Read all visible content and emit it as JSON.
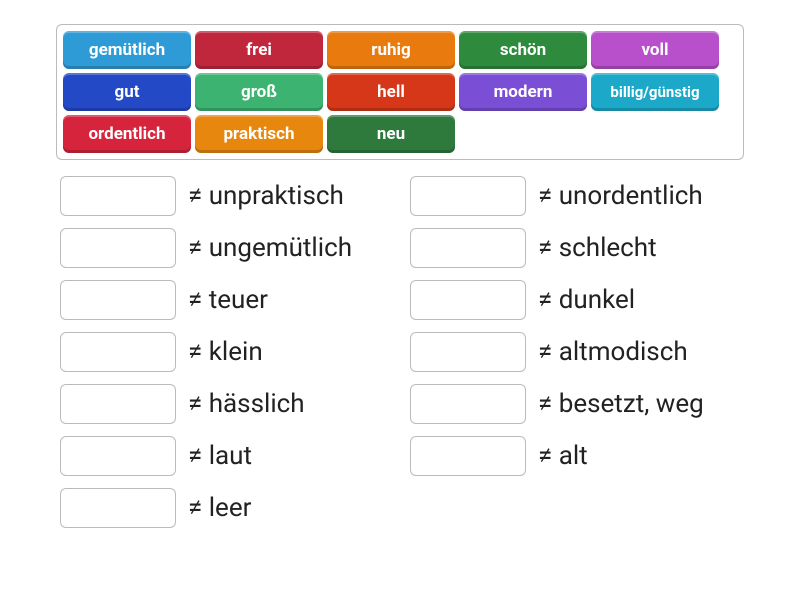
{
  "tiles": [
    {
      "text": "gemütlich",
      "color": "#2E9BD6"
    },
    {
      "text": "frei",
      "color": "#C0273C"
    },
    {
      "text": "ruhig",
      "color": "#E87A0E"
    },
    {
      "text": "schön",
      "color": "#2E8B3D"
    },
    {
      "text": "voll",
      "color": "#B84FCB"
    },
    {
      "text": "gut",
      "color": "#2449C6"
    },
    {
      "text": "groß",
      "color": "#3CB371"
    },
    {
      "text": "hell",
      "color": "#D63718"
    },
    {
      "text": "modern",
      "color": "#7A4FD6"
    },
    {
      "text": "billig/günstig",
      "color": "#1CA8C9"
    },
    {
      "text": "ordentlich",
      "color": "#D6243C"
    },
    {
      "text": "praktisch",
      "color": "#E8870E"
    },
    {
      "text": "neu",
      "color": "#2E7A3D"
    }
  ],
  "pairs": [
    {
      "label": "≠ unpraktisch"
    },
    {
      "label": "≠ ungemütlich"
    },
    {
      "label": "≠ teuer"
    },
    {
      "label": "≠ klein"
    },
    {
      "label": "≠ hässlich"
    },
    {
      "label": "≠ laut"
    },
    {
      "label": "≠ leer"
    },
    {
      "label": "≠ unordentlich"
    },
    {
      "label": "≠ schlecht"
    },
    {
      "label": "≠ dunkel"
    },
    {
      "label": "≠ altmodisch"
    },
    {
      "label": "≠ besetzt, weg"
    },
    {
      "label": "≠ alt"
    }
  ]
}
